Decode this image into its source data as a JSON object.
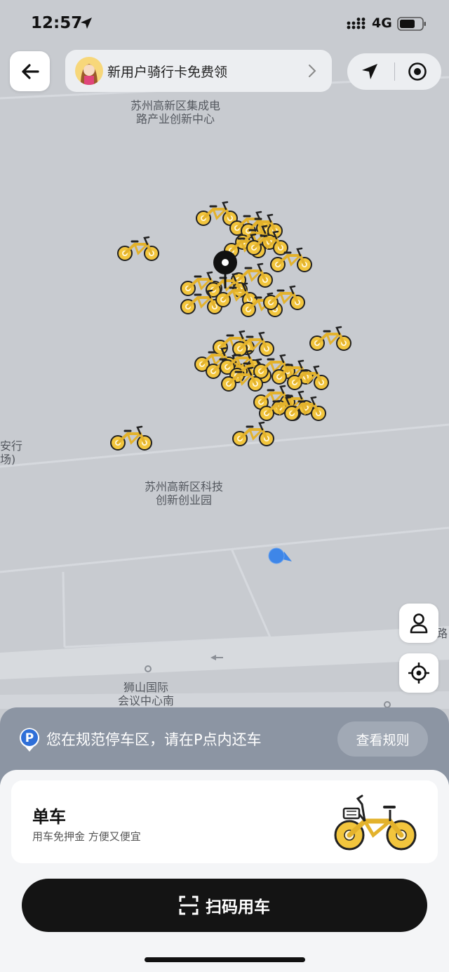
{
  "status_bar": {
    "time": "12:57",
    "network": "4G"
  },
  "top_bar": {
    "promo_text": "新用户骑行卡免费领"
  },
  "map": {
    "labels": [
      "苏州高新区集成电\n路产业创新中心",
      "苏州高新区科技\n创新创业园",
      "狮山国际\n会议中心南",
      "安行\n场)",
      "路"
    ]
  },
  "parking_notice": {
    "text": "您在规范停车区，请在P点内还车",
    "rules_button": "查看规则"
  },
  "vehicle_card": {
    "title": "单车",
    "subtitle": "用车免押金 方便又便宜"
  },
  "scan_button": {
    "label": "扫码用车"
  },
  "colors": {
    "bike_yellow": "#f2c53d",
    "map_background": "#c8cbd0",
    "user_location_blue": "#3e86e8",
    "button_dark": "#141414"
  }
}
